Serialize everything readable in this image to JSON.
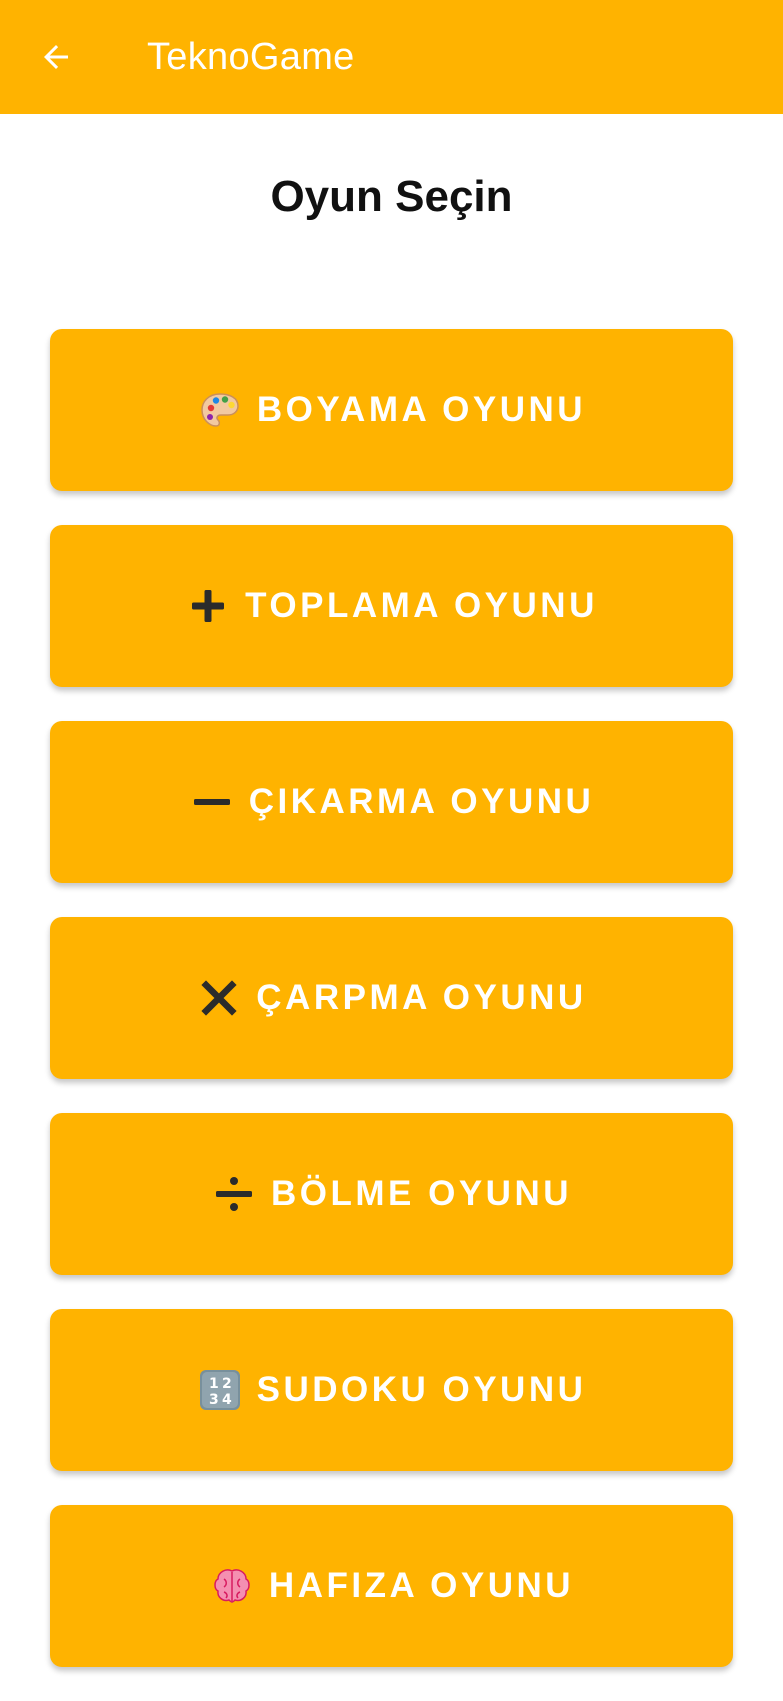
{
  "app_bar": {
    "title": "TeknoGame",
    "back_icon": "arrow-left-icon"
  },
  "page": {
    "heading": "Oyun Seçin"
  },
  "games": [
    {
      "label": "BOYAMA OYUNU",
      "icon": "palette-icon"
    },
    {
      "label": "TOPLAMA OYUNU",
      "icon": "plus-icon"
    },
    {
      "label": "ÇIKARMA OYUNU",
      "icon": "minus-icon"
    },
    {
      "label": "ÇARPMA OYUNU",
      "icon": "multiply-icon"
    },
    {
      "label": "BÖLME OYUNU",
      "icon": "divide-icon"
    },
    {
      "label": "SUDOKU OYUNU",
      "icon": "numbers-1234-icon"
    },
    {
      "label": "HAFIZA OYUNU",
      "icon": "brain-icon"
    }
  ],
  "colors": {
    "accent": "#FFB300",
    "text_on_accent": "#FFFFFF",
    "heading": "#111111"
  }
}
